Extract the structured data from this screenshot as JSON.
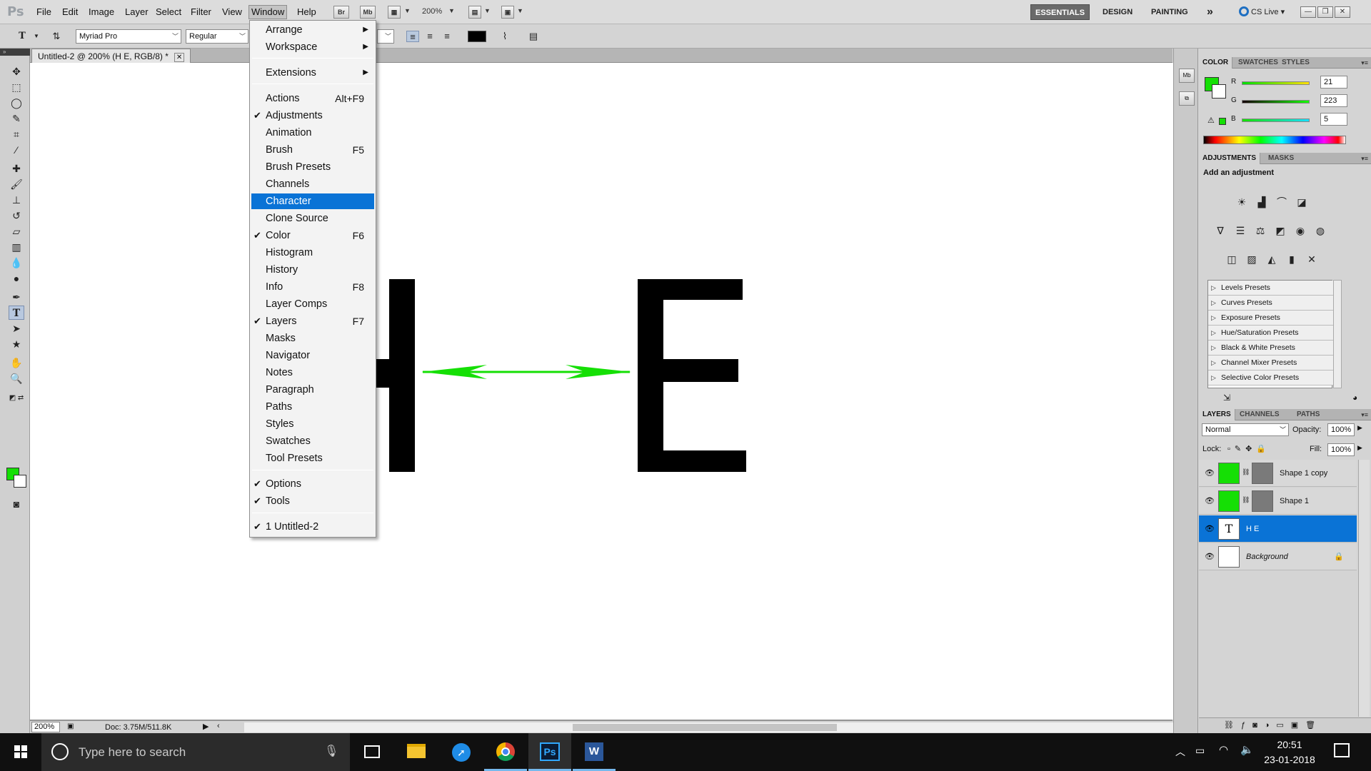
{
  "menubar": {
    "logo": "Ps",
    "items": [
      "File",
      "Edit",
      "Image",
      "Layer",
      "Select",
      "Filter",
      "View",
      "Window",
      "Help"
    ],
    "active_index": 7,
    "buttons": {
      "br": "Br",
      "mb": "Mb"
    },
    "zoom": "200%",
    "workspaces": [
      "ESSENTIALS",
      "DESIGN",
      "PAINTING"
    ],
    "more": "»",
    "cslive": "CS Live"
  },
  "options": {
    "font_family": "Myriad Pro",
    "font_style": "Regular",
    "text_color": "#000000"
  },
  "document": {
    "tab_title": "Untitled-2 @ 200% (H   E, RGB/8) *",
    "status_zoom": "200%",
    "doc_info": "Doc: 3.75M/511.8K",
    "letters": [
      "H",
      "E"
    ],
    "arrow_color": "#15df05"
  },
  "window_menu": {
    "items": [
      {
        "label": "Arrange",
        "submenu": true,
        "mnemonic": "A"
      },
      {
        "label": "Workspace",
        "submenu": true
      },
      {
        "sep": true
      },
      {
        "label": "Extensions",
        "submenu": true
      },
      {
        "sep": true
      },
      {
        "label": "Actions",
        "shortcut": "Alt+F9"
      },
      {
        "label": "Adjustments",
        "checked": true
      },
      {
        "label": "Animation"
      },
      {
        "label": "Brush",
        "shortcut": "F5"
      },
      {
        "label": "Brush Presets"
      },
      {
        "label": "Channels"
      },
      {
        "label": "Character",
        "highlight": true
      },
      {
        "label": "Clone Source"
      },
      {
        "label": "Color",
        "checked": true,
        "shortcut": "F6"
      },
      {
        "label": "Histogram"
      },
      {
        "label": "History"
      },
      {
        "label": "Info",
        "shortcut": "F8"
      },
      {
        "label": "Layer Comps"
      },
      {
        "label": "Layers",
        "checked": true,
        "shortcut": "F7"
      },
      {
        "label": "Masks"
      },
      {
        "label": "Navigator"
      },
      {
        "label": "Notes"
      },
      {
        "label": "Paragraph"
      },
      {
        "label": "Paths"
      },
      {
        "label": "Styles"
      },
      {
        "label": "Swatches"
      },
      {
        "label": "Tool Presets"
      },
      {
        "sep": true
      },
      {
        "label": "Options",
        "checked": true
      },
      {
        "label": "Tools",
        "checked": true
      },
      {
        "sep": true
      },
      {
        "label": "1 Untitled-2",
        "checked": true
      }
    ],
    "highlight_color": "#0a73d6"
  },
  "color_panel": {
    "tabs": [
      "COLOR",
      "SWATCHES",
      "STYLES"
    ],
    "r_label": "R",
    "g_label": "G",
    "b_label": "B",
    "r": "21",
    "g": "223",
    "b": "5",
    "fg_color": "#15df05"
  },
  "adjustments_panel": {
    "tabs": [
      "ADJUSTMENTS",
      "MASKS"
    ],
    "title": "Add an adjustment",
    "presets": [
      "Levels Presets",
      "Curves Presets",
      "Exposure Presets",
      "Hue/Saturation Presets",
      "Black & White Presets",
      "Channel Mixer Presets",
      "Selective Color Presets"
    ]
  },
  "layers_panel": {
    "tabs": [
      "LAYERS",
      "CHANNELS",
      "PATHS"
    ],
    "blend_mode": "Normal",
    "opacity_label": "Opacity:",
    "opacity": "100%",
    "lock_label": "Lock:",
    "fill_label": "Fill:",
    "fill": "100%",
    "layers": [
      {
        "name": "Shape 1 copy",
        "type": "shape"
      },
      {
        "name": "Shape 1",
        "type": "shape"
      },
      {
        "name": "H  E",
        "type": "text",
        "selected": true
      },
      {
        "name": "Background",
        "type": "background",
        "locked": true
      }
    ]
  },
  "taskbar": {
    "search_placeholder": "Type here to search",
    "time": "20:51",
    "date": "23-01-2018"
  }
}
